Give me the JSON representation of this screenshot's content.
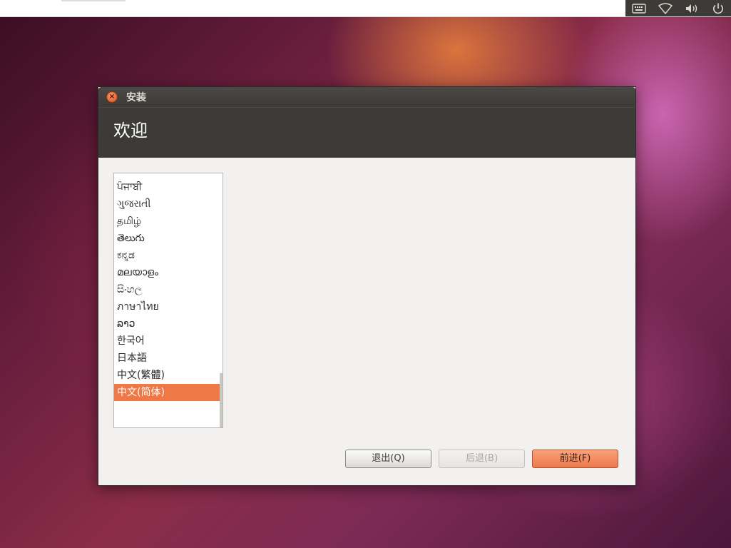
{
  "panel": {
    "indicators": [
      "keyboard-icon",
      "wifi-icon",
      "volume-icon",
      "power-icon"
    ]
  },
  "dialog": {
    "window_title": "安装",
    "page_title": "欢迎",
    "languages": [
      "ਪੰਜਾਬੀ",
      "ગુજરાતી",
      "தமிழ்",
      "తెలుగు",
      "ಕನ್ನಡ",
      "മലയാളം",
      "සිංහල",
      "ภาษาไทย",
      "ລາວ",
      "한국어",
      "日本語",
      "中文(繁體)",
      "中文(简体)"
    ],
    "selected_language": "中文(简体)",
    "buttons": {
      "quit": "退出(Q)",
      "back": "后退(B)",
      "forward": "前进(F)"
    }
  },
  "colors": {
    "accent": "#f07746",
    "header_bg": "#3c3b37",
    "dialog_bg": "#f2f1f0"
  }
}
